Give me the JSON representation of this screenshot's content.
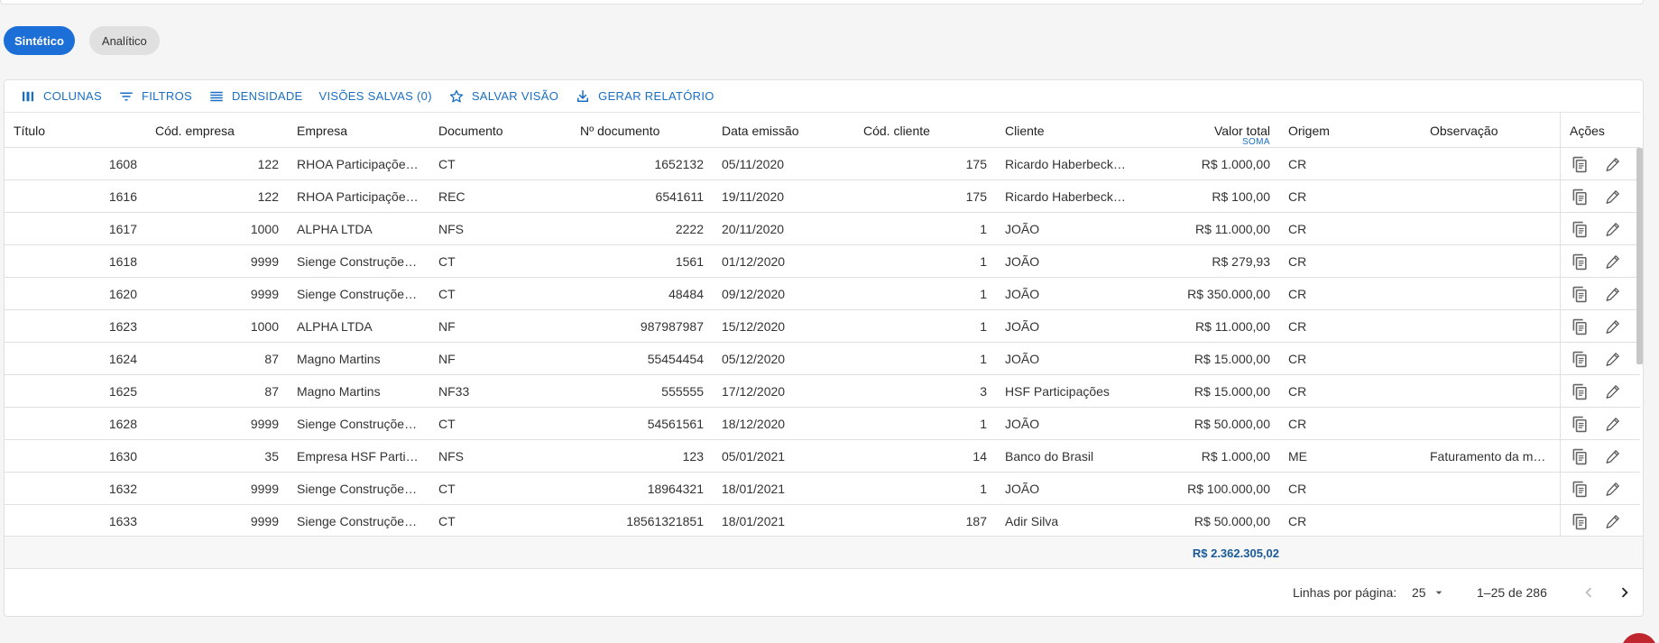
{
  "view_toggle": {
    "synthetic": "Sintético",
    "analytic": "Analítico"
  },
  "toolbar": {
    "columns": "COLUNAS",
    "filters": "FILTROS",
    "density": "DENSIDADE",
    "saved_views": "VISÕES SALVAS (0)",
    "save_view": "SALVAR VISÃO",
    "report": "GERAR RELATÓRIO"
  },
  "columns": {
    "titulo": "Título",
    "cod_empresa": "Cód. empresa",
    "empresa": "Empresa",
    "documento": "Documento",
    "num_documento": "Nº documento",
    "data_emissao": "Data emissão",
    "cod_cliente": "Cód. cliente",
    "cliente": "Cliente",
    "valor_total": "Valor total",
    "valor_total_agg": "SOMA",
    "origem": "Origem",
    "observacao": "Observação",
    "acoes": "Ações"
  },
  "rows": [
    {
      "titulo": "1608",
      "cod_empresa": "122",
      "empresa": "RHOA Participações LTDA",
      "documento": "CT",
      "num_documento": "1652132",
      "data_emissao": "05/11/2020",
      "cod_cliente": "175",
      "cliente": "Ricardo Haberbeck Filho",
      "valor_total": "R$ 1.000,00",
      "origem": "CR",
      "observacao": ""
    },
    {
      "titulo": "1616",
      "cod_empresa": "122",
      "empresa": "RHOA Participações LTDA",
      "documento": "REC",
      "num_documento": "6541611",
      "data_emissao": "19/11/2020",
      "cod_cliente": "175",
      "cliente": "Ricardo Haberbeck Filho",
      "valor_total": "R$ 100,00",
      "origem": "CR",
      "observacao": ""
    },
    {
      "titulo": "1617",
      "cod_empresa": "1000",
      "empresa": "ALPHA LTDA",
      "documento": "NFS",
      "num_documento": "2222",
      "data_emissao": "20/11/2020",
      "cod_cliente": "1",
      "cliente": "JOÃO",
      "valor_total": "R$ 11.000,00",
      "origem": "CR",
      "observacao": ""
    },
    {
      "titulo": "1618",
      "cod_empresa": "9999",
      "empresa": "Sienge Construções LTDA",
      "documento": "CT",
      "num_documento": "1561",
      "data_emissao": "01/12/2020",
      "cod_cliente": "1",
      "cliente": "JOÃO",
      "valor_total": "R$ 279,93",
      "origem": "CR",
      "observacao": ""
    },
    {
      "titulo": "1620",
      "cod_empresa": "9999",
      "empresa": "Sienge Construções LTDA",
      "documento": "CT",
      "num_documento": "48484",
      "data_emissao": "09/12/2020",
      "cod_cliente": "1",
      "cliente": "JOÃO",
      "valor_total": "R$ 350.000,00",
      "origem": "CR",
      "observacao": ""
    },
    {
      "titulo": "1623",
      "cod_empresa": "1000",
      "empresa": "ALPHA LTDA",
      "documento": "NF",
      "num_documento": "987987987",
      "data_emissao": "15/12/2020",
      "cod_cliente": "1",
      "cliente": "JOÃO",
      "valor_total": "R$ 11.000,00",
      "origem": "CR",
      "observacao": ""
    },
    {
      "titulo": "1624",
      "cod_empresa": "87",
      "empresa": "Magno Martins",
      "documento": "NF",
      "num_documento": "55454454",
      "data_emissao": "05/12/2020",
      "cod_cliente": "1",
      "cliente": "JOÃO",
      "valor_total": "R$ 15.000,00",
      "origem": "CR",
      "observacao": ""
    },
    {
      "titulo": "1625",
      "cod_empresa": "87",
      "empresa": "Magno Martins",
      "documento": "NF33",
      "num_documento": "555555",
      "data_emissao": "17/12/2020",
      "cod_cliente": "3",
      "cliente": "HSF Participações",
      "valor_total": "R$ 15.000,00",
      "origem": "CR",
      "observacao": ""
    },
    {
      "titulo": "1628",
      "cod_empresa": "9999",
      "empresa": "Sienge Construções LTDA",
      "documento": "CT",
      "num_documento": "54561561",
      "data_emissao": "18/12/2020",
      "cod_cliente": "1",
      "cliente": "JOÃO",
      "valor_total": "R$ 50.000,00",
      "origem": "CR",
      "observacao": ""
    },
    {
      "titulo": "1630",
      "cod_empresa": "35",
      "empresa": "Empresa HSF Participações",
      "documento": "NFS",
      "num_documento": "123",
      "data_emissao": "05/01/2021",
      "cod_cliente": "14",
      "cliente": "Banco do Brasil",
      "valor_total": "R$ 1.000,00",
      "origem": "ME",
      "observacao": "Faturamento da mensalidade"
    },
    {
      "titulo": "1632",
      "cod_empresa": "9999",
      "empresa": "Sienge Construções LTDA",
      "documento": "CT",
      "num_documento": "18964321",
      "data_emissao": "18/01/2021",
      "cod_cliente": "1",
      "cliente": "JOÃO",
      "valor_total": "R$ 100.000,00",
      "origem": "CR",
      "observacao": ""
    },
    {
      "titulo": "1633",
      "cod_empresa": "9999",
      "empresa": "Sienge Construções LTDA",
      "documento": "CT",
      "num_documento": "18561321851",
      "data_emissao": "18/01/2021",
      "cod_cliente": "187",
      "cliente": "Adir Silva",
      "valor_total": "R$ 50.000,00",
      "origem": "CR",
      "observacao": ""
    }
  ],
  "summary": {
    "valor_total_sum": "R$ 2.362.305,02"
  },
  "pagination": {
    "rows_per_page_label": "Linhas por página:",
    "rows_per_page": "25",
    "range": "1–25 de 286"
  },
  "icons": {
    "columns": "view-column-icon",
    "filters": "filter-list-icon",
    "density": "density-icon",
    "save_view": "star-outline-icon",
    "report": "download-icon",
    "copy": "copy-icon",
    "edit": "pencil-icon"
  },
  "colors": {
    "primary": "#1c6fd6",
    "link": "#1a6fc4",
    "fab": "#c0262d"
  }
}
